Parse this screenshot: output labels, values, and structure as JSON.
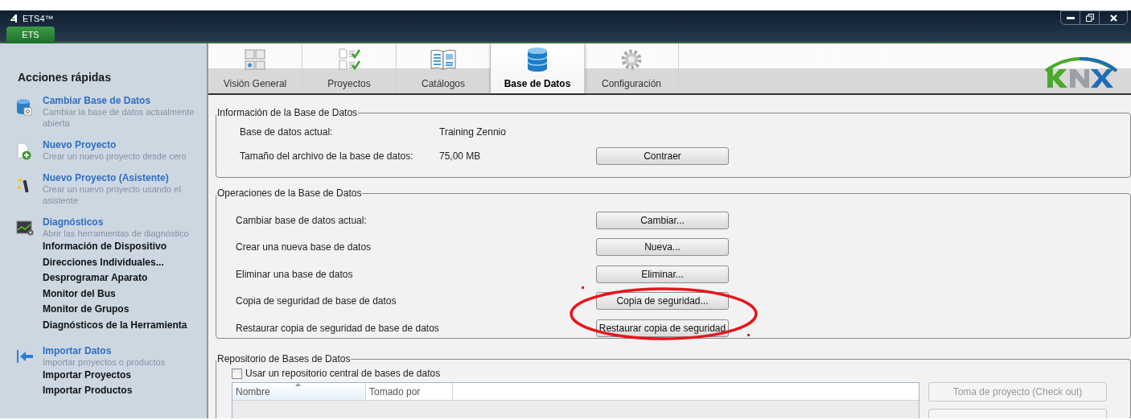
{
  "window": {
    "app_title": "ETS4™",
    "app_tab": "ETS"
  },
  "sidebar": {
    "title": "Acciones rápidas",
    "sections": [
      {
        "kind": "database",
        "title": "Cambiar Base de Datos",
        "description": "Cambiar la base de datos actualmente abierta"
      },
      {
        "kind": "new",
        "title": "Nuevo Proyecto",
        "description": "Crear un nuevo proyecto desde cero"
      },
      {
        "kind": "wizard",
        "title": "Nuevo Proyecto (Asistente)",
        "description": "Crear un nuevo proyecto usando el asistente"
      },
      {
        "kind": "monitor",
        "title": "Diagnósticos",
        "description": "Abrir las herramientas de diagnóstico",
        "links": [
          "Información de Dispositivo",
          "Direcciones Individuales...",
          "Desprogramar Aparato",
          "Monitor del Bus",
          "Monitor de Grupos",
          "Diagnósticos de la Herramienta"
        ]
      },
      {
        "kind": "import",
        "title": "Importar Datos",
        "description": "Importar proyectos o productos",
        "links": [
          "Importar Proyectos",
          "Importar Productos"
        ]
      }
    ]
  },
  "tabs": [
    {
      "kind": "overview",
      "label": "Visión General",
      "selected": false
    },
    {
      "kind": "projects",
      "label": "Proyectos",
      "selected": false
    },
    {
      "kind": "catalog",
      "label": "Catálogos",
      "selected": false
    },
    {
      "kind": "database",
      "label": "Base de Datos",
      "selected": true
    },
    {
      "kind": "settings",
      "label": "Configuración",
      "selected": false
    }
  ],
  "info_group": {
    "title": "Información de la Base de Datos",
    "rows": [
      {
        "label": "Base de datos actual:",
        "value": "Training Zennio"
      },
      {
        "label": "Tamaño del archivo de la base de datos:",
        "value": "75,00 MB",
        "button": "Contraer"
      }
    ]
  },
  "operations_group": {
    "title": "Operaciones de la Base de Datos",
    "rows": [
      {
        "label": "Cambiar base de datos actual:",
        "button": "Cambiar..."
      },
      {
        "label": "Crear una nueva base de datos",
        "button": "Nueva..."
      },
      {
        "label": "Eliminar una base de datos",
        "button": "Eliminar..."
      },
      {
        "label": "Copia de seguridad de base de datos",
        "button": "Copia de seguridad..."
      },
      {
        "label": "Restaurar copia de seguridad de base de datos",
        "button": "Restaurar copia de seguridad"
      }
    ]
  },
  "repository_group": {
    "title": "Repositorio de Bases de Datos",
    "checkbox": {
      "label": "Usar un repositorio central de bases de datos",
      "checked": false
    },
    "table": {
      "columns": [
        {
          "label": "Nombre",
          "sorted": true
        },
        {
          "label": "Tomado por",
          "sorted": false
        }
      ]
    },
    "buttons": [
      {
        "label": "Toma de proyecto (Check out)",
        "disabled": true
      },
      {
        "disabled": true
      }
    ]
  }
}
